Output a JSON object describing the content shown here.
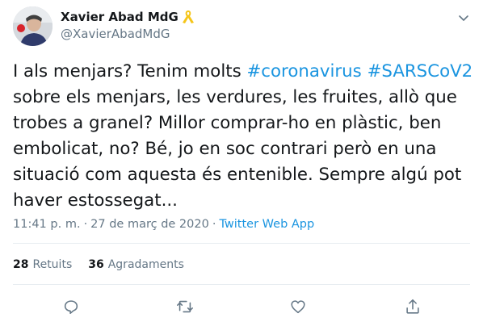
{
  "user": {
    "name": "Xavier Abad MdG",
    "handle": "@XavierAbadMdG"
  },
  "tweet": {
    "lines": [
      {
        "parts": [
          {
            "text": "I als menjars? Tenim molts ",
            "type": "text"
          },
          {
            "text": "#coronavirus",
            "type": "hashtag"
          },
          {
            "text": " ",
            "type": "text"
          },
          {
            "text": "#SARSCoV2",
            "type": "hashtag"
          }
        ]
      },
      {
        "parts": [
          {
            "text": "sobre els menjars, les verdures, les fruites, allò que",
            "type": "text"
          }
        ]
      },
      {
        "parts": [
          {
            "text": "trobes a granel? Millor comprar-ho en plàstic, ben",
            "type": "text"
          }
        ]
      },
      {
        "parts": [
          {
            "text": "embolicat, no? Bé, jo en soc contrari però en una",
            "type": "text"
          }
        ]
      },
      {
        "parts": [
          {
            "text": "situació com aquesta és entenible. Sempre algú pot",
            "type": "text"
          }
        ]
      },
      {
        "parts": [
          {
            "text": "haver estossegat...",
            "type": "text"
          }
        ]
      }
    ]
  },
  "meta": {
    "time": "11:41 p. m.",
    "separator": "·",
    "date": "27 de març de 2020",
    "source": "Twitter Web App"
  },
  "stats": {
    "retweets_count": "28",
    "retweets_label": "Retuits",
    "likes_count": "36",
    "likes_label": "Agradaments"
  },
  "icons": {
    "reply": "reply-icon",
    "retweet": "retweet-icon",
    "like": "heart-icon",
    "share": "share-icon",
    "more": "chevron-down-icon",
    "ribbon": "yellow-ribbon-icon"
  },
  "colors": {
    "hashtag": "#1b95e0",
    "secondary_text": "#657786",
    "ribbon": "#f5c518"
  }
}
